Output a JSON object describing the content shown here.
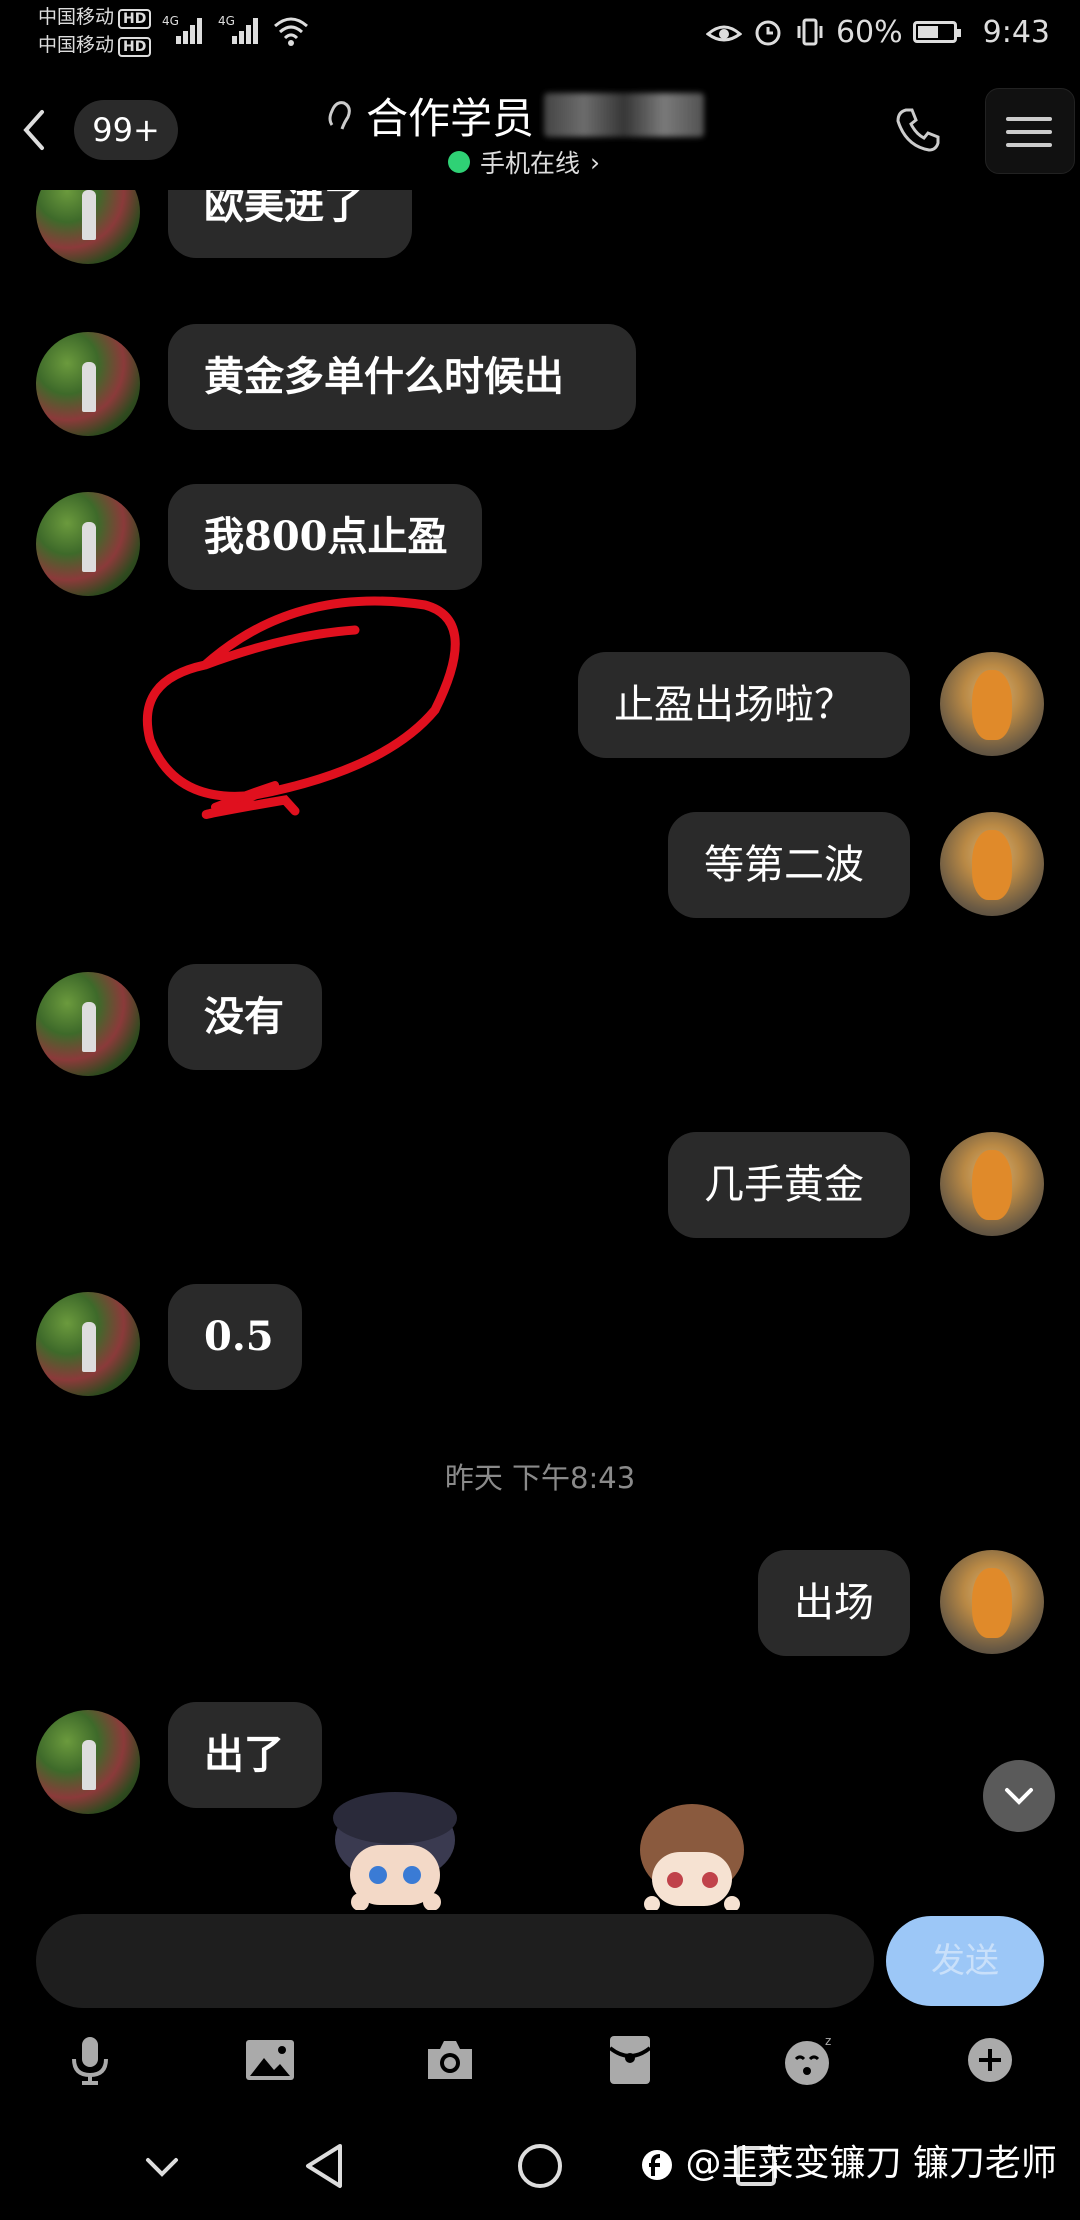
{
  "status_bar": {
    "carrier_1": "中国移动",
    "carrier_2": "中国移动",
    "hd": "HD",
    "network": "4G",
    "battery": "60%",
    "battery_level": 0.6,
    "time": "9:43"
  },
  "header": {
    "unread_count": "99+",
    "title": "合作学员",
    "online_status": "手机在线",
    "online_chevron": "›"
  },
  "messages": [
    {
      "side": "in",
      "text": "欧美进了"
    },
    {
      "side": "in",
      "text": "黄金多单什么时候出"
    },
    {
      "side": "in",
      "text": "我800点止盈"
    },
    {
      "side": "out",
      "text": "止盈出场啦？"
    },
    {
      "side": "out",
      "text": "等第二波"
    },
    {
      "side": "in",
      "text": "没有"
    },
    {
      "side": "out",
      "text": "几手黄金"
    },
    {
      "side": "in",
      "text": "0.5"
    },
    {
      "side": "out",
      "text": "出场"
    },
    {
      "side": "in",
      "text": "出了"
    }
  ],
  "timestamp": "昨天 下午8:43",
  "input": {
    "value": "",
    "placeholder": ""
  },
  "send_label": "发送",
  "toolbar_icons": [
    "microphone-icon",
    "image-icon",
    "camera-icon",
    "red-packet-icon",
    "sticker-icon",
    "plus-icon"
  ],
  "nav_icons": [
    "chevron-down-icon",
    "back-triangle-icon",
    "home-circle-icon",
    "recents-square-icon"
  ],
  "watermark": "@韭菜变镰刀 镰刀老师",
  "colors": {
    "background": "#000000",
    "bubble": "#2a2a2a",
    "online_dot": "#2fd175",
    "send_button": "#9cc7f7",
    "annotation": "#e0101e"
  }
}
